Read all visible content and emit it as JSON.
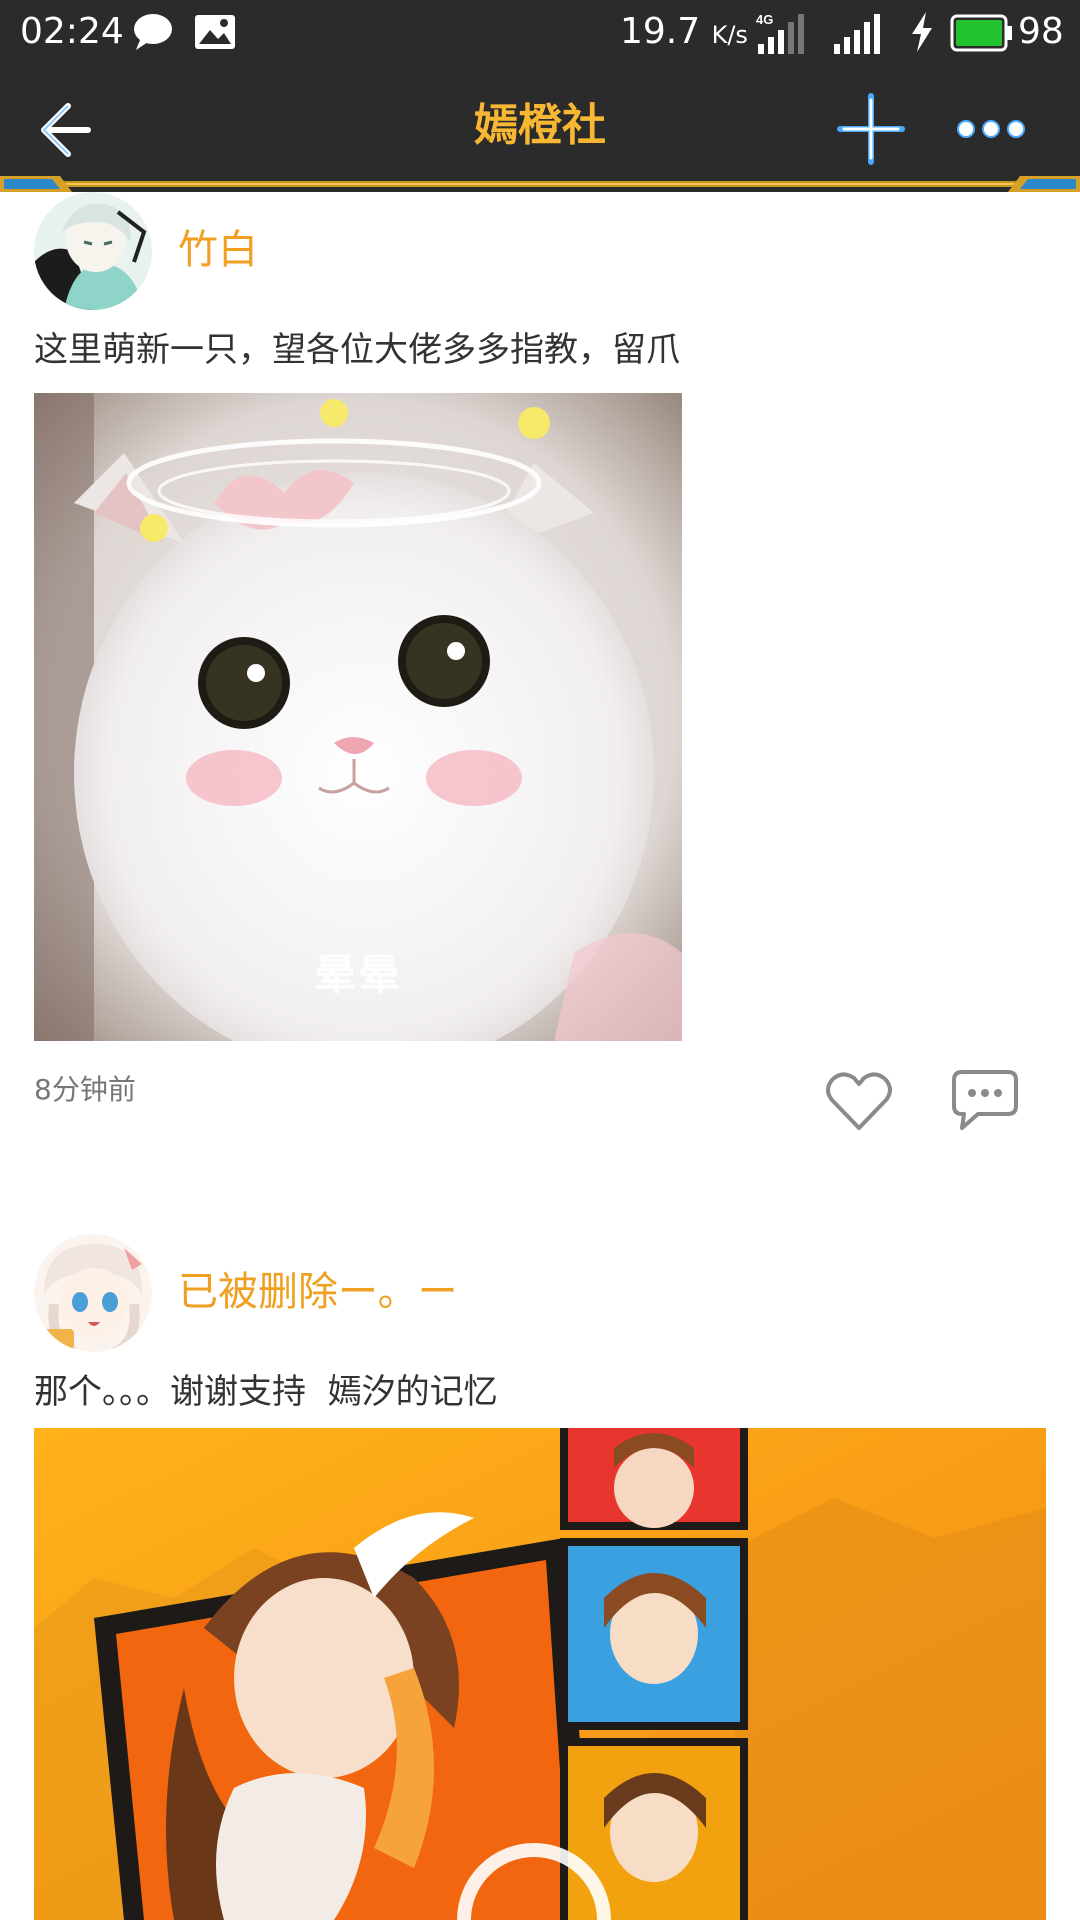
{
  "status_bar": {
    "time": "02:24",
    "net_speed": "19.7",
    "net_unit": "K/s",
    "network": "4G",
    "battery": "98"
  },
  "header": {
    "title": "嫣橙社",
    "back_icon": "back-arrow-icon",
    "add_icon": "plus-icon",
    "more_icon": "more-dots-icon"
  },
  "posts": [
    {
      "username": "竹白",
      "text": "这里萌新一只，望各位大佬多多指教，留爪",
      "image_caption": "晕晕",
      "time": "8分钟前",
      "like_icon": "heart-icon",
      "comment_icon": "comment-icon"
    },
    {
      "username": "已被删除ー。ー",
      "text": "那个。。。谢谢支持  嫣汐的记忆"
    }
  ],
  "colors": {
    "bar_bg": "#2b2b2b",
    "title": "#f7b733",
    "username": "#f0a020",
    "accent_blue": "#4aa8ff",
    "battery": "#22c32e"
  }
}
